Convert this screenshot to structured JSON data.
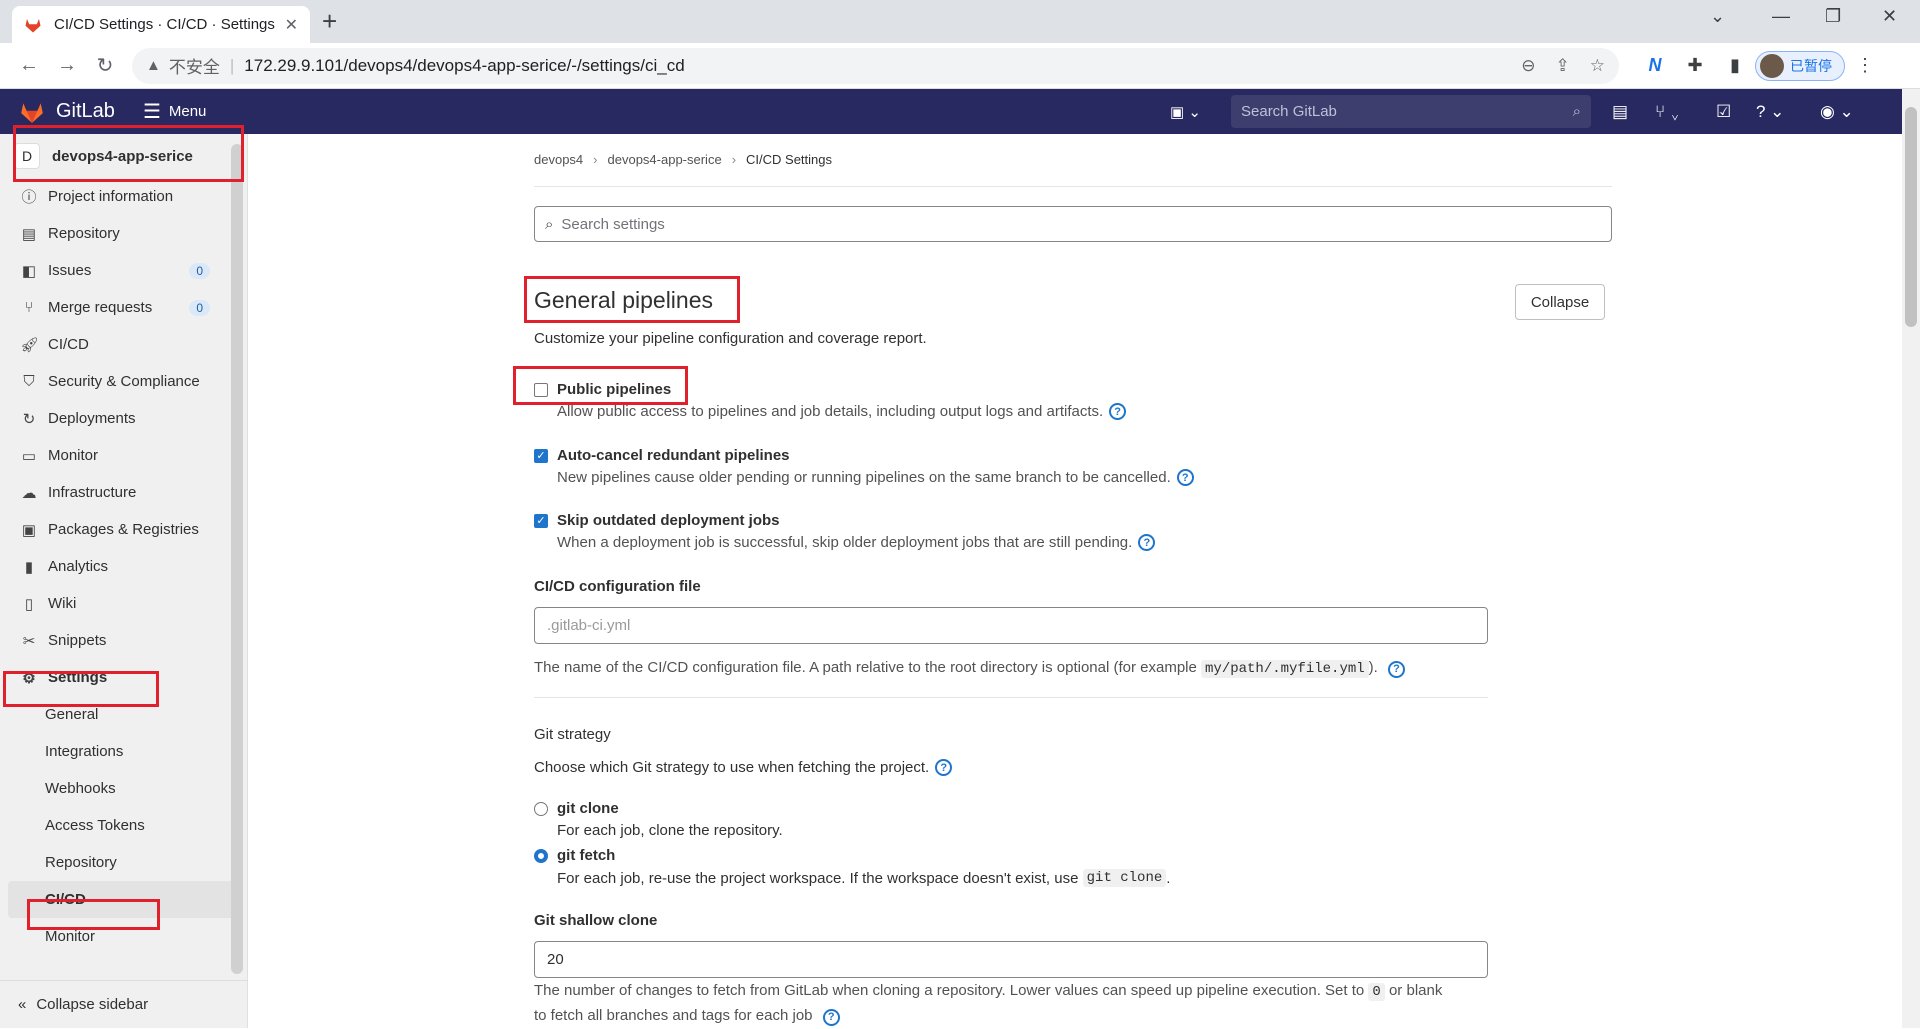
{
  "browser": {
    "tab_title": "CI/CD Settings · CI/CD · Settings",
    "insecure_label": "不安全",
    "url": "172.29.9.101/devops4/devops4-app-serice/-/settings/ci_cd",
    "profile_label": "已暂停"
  },
  "header": {
    "brand": "GitLab",
    "menu_label": "Menu",
    "search_placeholder": "Search GitLab"
  },
  "sidebar": {
    "project_initial": "D",
    "project_name": "devops4-app-serice",
    "items": [
      {
        "label": "Project information",
        "icon": "info-icon"
      },
      {
        "label": "Repository",
        "icon": "document-icon"
      },
      {
        "label": "Issues",
        "icon": "issues-icon",
        "badge": "0"
      },
      {
        "label": "Merge requests",
        "icon": "merge-request-icon",
        "badge": "0"
      },
      {
        "label": "CI/CD",
        "icon": "rocket-icon"
      },
      {
        "label": "Security & Compliance",
        "icon": "shield-icon"
      },
      {
        "label": "Deployments",
        "icon": "deployments-icon"
      },
      {
        "label": "Monitor",
        "icon": "monitor-icon"
      },
      {
        "label": "Infrastructure",
        "icon": "infrastructure-icon"
      },
      {
        "label": "Packages & Registries",
        "icon": "package-icon"
      },
      {
        "label": "Analytics",
        "icon": "chart-icon"
      },
      {
        "label": "Wiki",
        "icon": "book-icon"
      },
      {
        "label": "Snippets",
        "icon": "scissors-icon"
      },
      {
        "label": "Settings",
        "icon": "gear-icon"
      }
    ],
    "settings_sub": [
      "General",
      "Integrations",
      "Webhooks",
      "Access Tokens",
      "Repository",
      "CI/CD",
      "Monitor"
    ],
    "collapse_label": "Collapse sidebar"
  },
  "main": {
    "breadcrumbs": [
      "devops4",
      "devops4-app-serice",
      "CI/CD Settings"
    ],
    "search_placeholder": "Search settings",
    "section_title": "General pipelines",
    "collapse_label": "Collapse",
    "section_desc": "Customize your pipeline configuration and coverage report.",
    "options": [
      {
        "label": "Public pipelines",
        "checked": false,
        "help": "Allow public access to pipelines and job details, including output logs and artifacts."
      },
      {
        "label": "Auto-cancel redundant pipelines",
        "checked": true,
        "help": "New pipelines cause older pending or running pipelines on the same branch to be cancelled."
      },
      {
        "label": "Skip outdated deployment jobs",
        "checked": true,
        "help": "When a deployment job is successful, skip older deployment jobs that are still pending."
      }
    ],
    "config_file": {
      "label": "CI/CD configuration file",
      "placeholder": ".gitlab-ci.yml",
      "help_before": "The name of the CI/CD configuration file. A path relative to the root directory is optional (for example",
      "help_code": "my/path/.myfile.yml",
      "help_after": ")."
    },
    "git_strategy": {
      "title": "Git strategy",
      "desc": "Choose which Git strategy to use when fetching the project.",
      "options": [
        {
          "label": "git clone",
          "checked": false,
          "help": "For each job, clone the repository."
        },
        {
          "label": "git fetch",
          "checked": true,
          "help": "For each job, re-use the project workspace. If the workspace doesn't exist, use",
          "help_code": "git clone",
          "help_after": "."
        }
      ]
    },
    "shallow_clone": {
      "label": "Git shallow clone",
      "value": "20",
      "help_line1": "The number of changes to fetch from GitLab when cloning a repository. Lower values can speed up pipeline execution. Set to",
      "help_code": "0",
      "help_line1_after": "or blank",
      "help_line2": "to fetch all branches and tags for each job"
    }
  }
}
